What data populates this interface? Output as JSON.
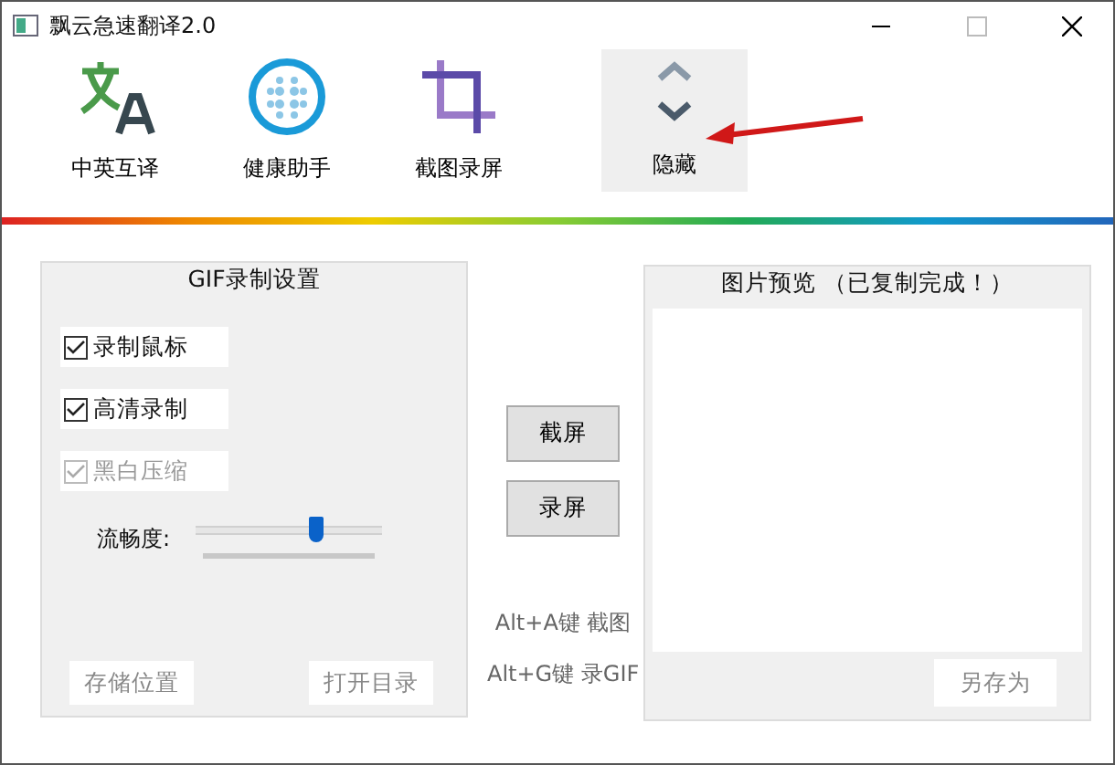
{
  "window": {
    "title": "飘云急速翻译2.0"
  },
  "toolbar": [
    {
      "kind": "translate",
      "label": "中英互译",
      "selected": false
    },
    {
      "kind": "health",
      "label": "健康助手",
      "selected": false
    },
    {
      "kind": "crop",
      "label": "截图录屏",
      "selected": false
    },
    {
      "kind": "toggle",
      "label": "隐藏",
      "selected": true
    }
  ],
  "gif_settings": {
    "title": "GIF录制设置",
    "options": [
      {
        "label": "录制鼠标",
        "checked": true,
        "disabled": false
      },
      {
        "label": "高清录制",
        "checked": true,
        "disabled": false
      },
      {
        "label": "黑白压缩",
        "checked": true,
        "disabled": true
      }
    ],
    "slider": {
      "label": "流畅度:",
      "level": 0.65
    },
    "buttons": [
      {
        "label": "存储位置",
        "disabled": true
      },
      {
        "label": "打开目录",
        "disabled": true
      }
    ]
  },
  "actions": [
    {
      "label": "截屏"
    },
    {
      "label": "录屏"
    }
  ],
  "hotkeys": [
    "Alt+A键 截图",
    "Alt+G键 录GIF"
  ],
  "preview": {
    "title": "图片预览 （已复制完成！）",
    "button": {
      "label": "另存为",
      "disabled": true
    }
  }
}
